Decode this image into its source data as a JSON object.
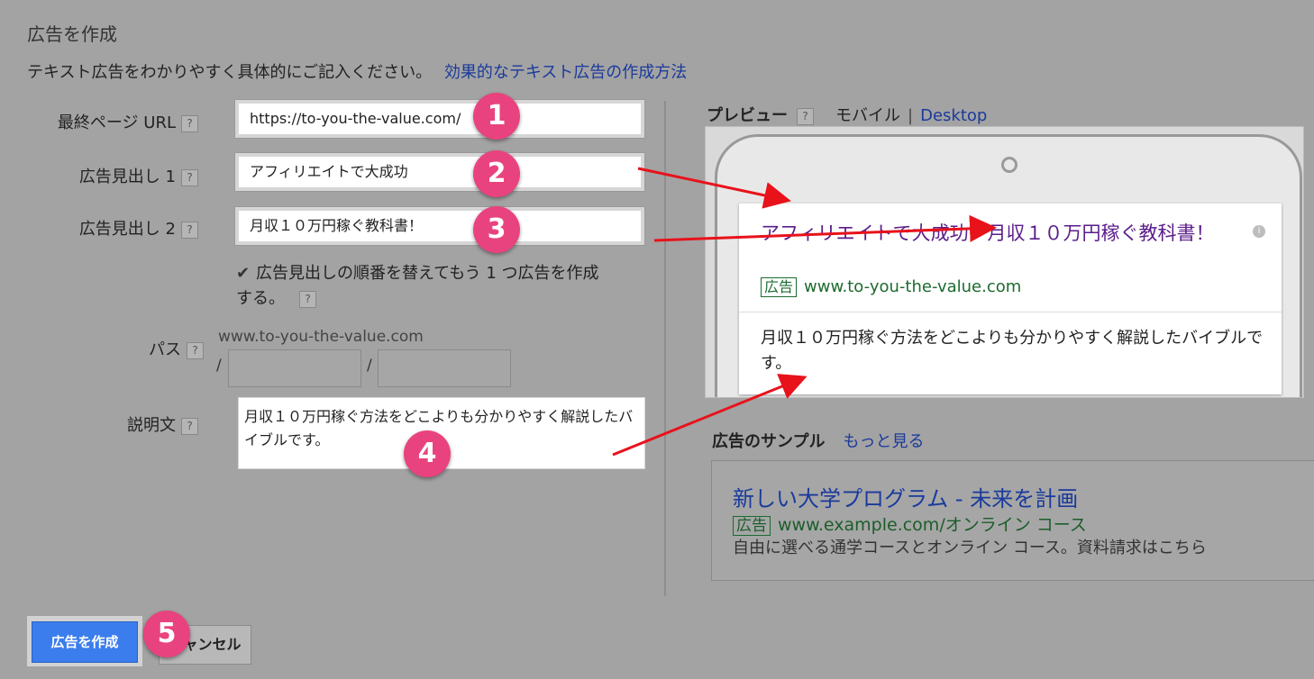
{
  "page": {
    "title": "広告を作成",
    "intro_text": "テキスト広告をわかりやすく具体的にご記入ください。",
    "intro_link": "効果的なテキスト広告の作成方法"
  },
  "form": {
    "final_url_label": "最終ページ URL",
    "final_url_value": "https://to-you-the-value.com/",
    "headline1_label": "広告見出し 1",
    "headline1_value": "アフィリエイトで大成功",
    "headline2_label": "広告見出し 2",
    "headline2_value": "月収１０万円稼ぐ教科書！",
    "reorder_checkbox_line1": "広告見出しの順番を替えてもう 1 つ広告を作成",
    "reorder_checkbox_line2": "する。",
    "path_label": "パス",
    "path_domain": "www.to-you-the-value.com",
    "path_sep": "/",
    "description_label": "説明文",
    "description_value": "月収１０万円稼ぐ方法をどこよりも分かりやすく解説したバイブルです。",
    "help_icon": "?"
  },
  "preview": {
    "label": "プレビュー",
    "mobile_tab": "モバイル",
    "separator": "|",
    "desktop_tab": "Desktop",
    "ad_headline": "アフィリエイトで大成功 - 月収１０万円稼ぐ教科書！",
    "ad_badge": "広告",
    "ad_url": "www.to-you-the-value.com",
    "ad_description": "月収１０万円稼ぐ方法をどこよりも分かりやすく解説したバイブルです。",
    "info_icon": "i"
  },
  "sample": {
    "label": "広告のサンプル",
    "more_link": "もっと見る",
    "title": "新しい大学プログラム - 未来を計画",
    "badge": "広告",
    "url": "www.example.com/オンライン コース",
    "description": "自由に選べる通学コースとオンライン コース。資料請求はこちら"
  },
  "buttons": {
    "create": "広告を作成",
    "cancel": "キャンセル"
  },
  "annotations": [
    "1",
    "2",
    "3",
    "4",
    "5"
  ],
  "colors": {
    "accent_blue": "#3b7ded",
    "link_blue": "#1a3a9c",
    "badge_pink": "#e8437f",
    "arrow_red": "#e8121b",
    "ad_green": "#1b6b2e"
  }
}
